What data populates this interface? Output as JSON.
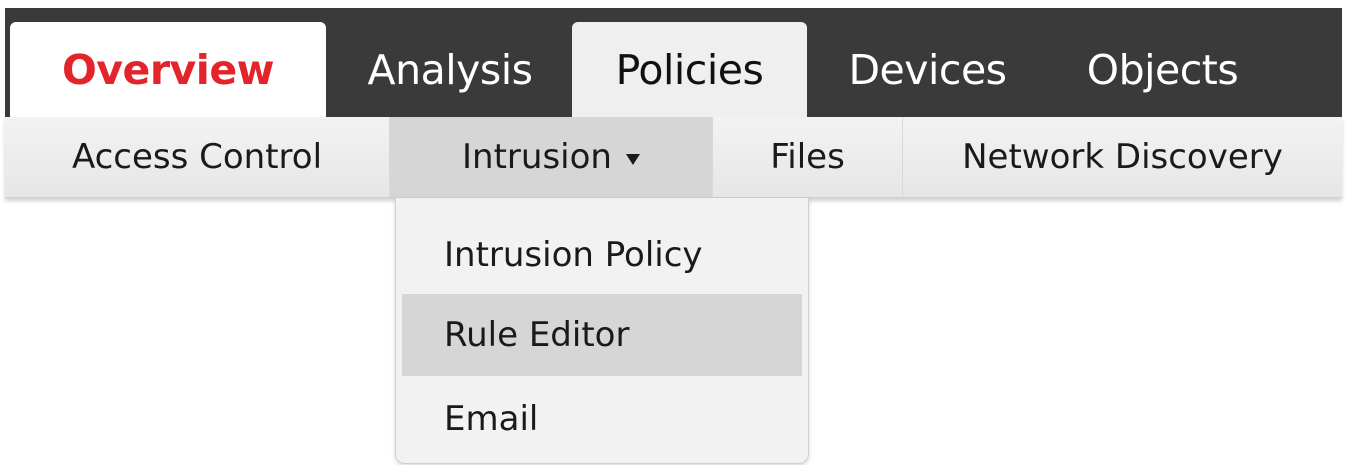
{
  "top_tabs": [
    {
      "label": "Overview",
      "state": "active-red"
    },
    {
      "label": "Analysis",
      "state": "inactive"
    },
    {
      "label": "Policies",
      "state": "active"
    },
    {
      "label": "Devices",
      "state": "inactive"
    },
    {
      "label": "Objects",
      "state": "inactive"
    }
  ],
  "sub_nav": [
    {
      "label": "Access Control"
    },
    {
      "label": "Intrusion",
      "has_dropdown": true,
      "selected": true
    },
    {
      "label": "Files"
    },
    {
      "label": "Network Discovery"
    }
  ],
  "intrusion_menu": {
    "items": [
      {
        "label": "Intrusion Policy"
      },
      {
        "label": "Rule Editor",
        "hovered": true
      },
      {
        "label": "Email"
      }
    ]
  },
  "colors": {
    "topbar_bg": "#3a3a3a",
    "overview_accent": "#e3242b",
    "subbar_bg": "#eeeeee",
    "selected_bg": "#d6d6d6"
  },
  "icons": {
    "dropdown_caret": "caret-down-icon"
  }
}
